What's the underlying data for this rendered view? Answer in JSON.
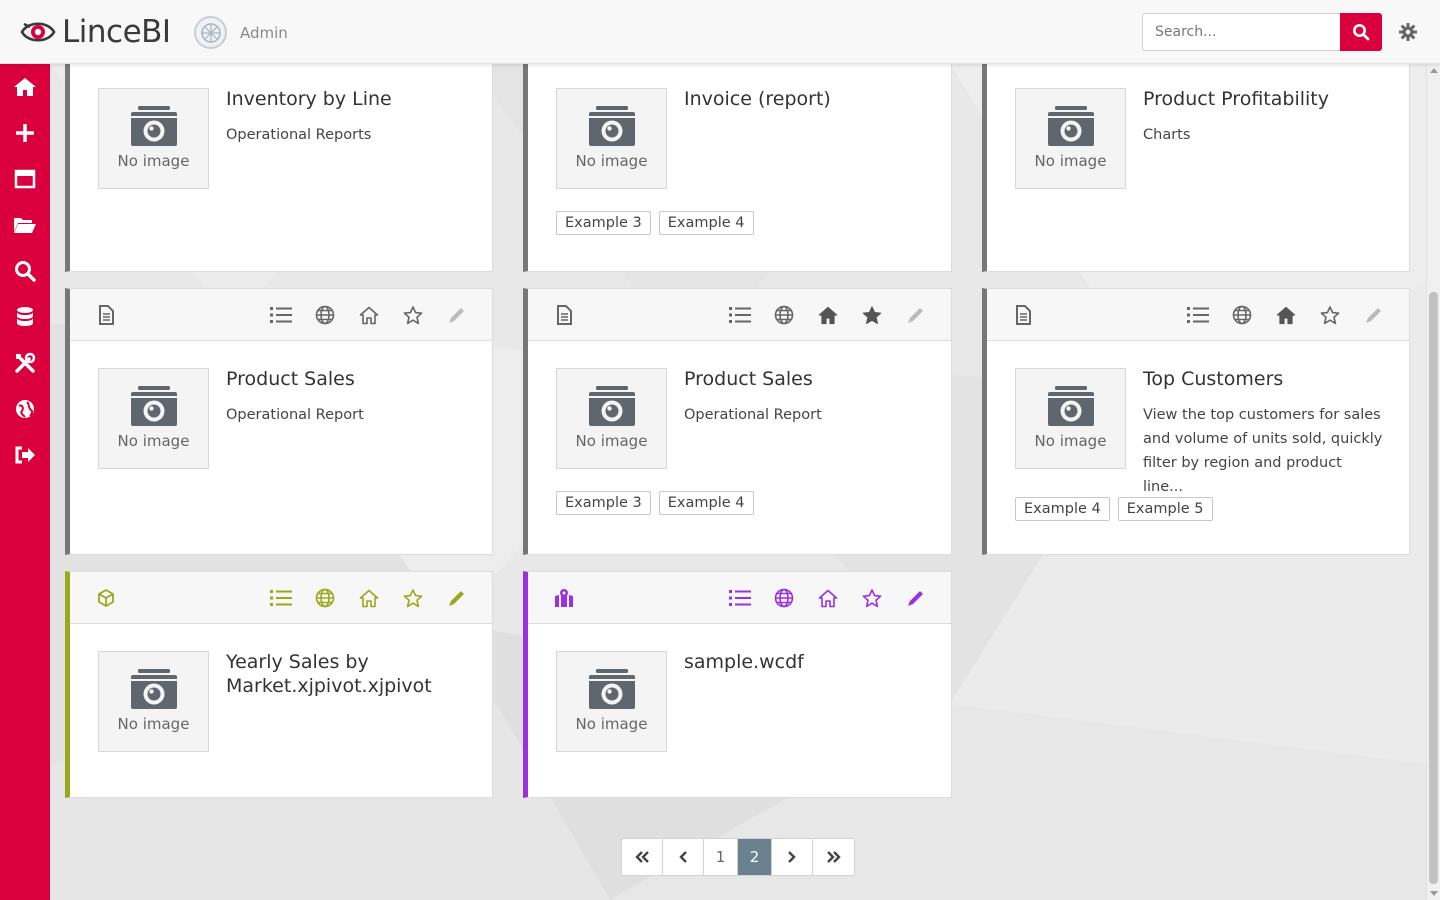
{
  "app": {
    "name": "LinceBI",
    "user": "Admin",
    "search_placeholder": "Search...",
    "brand_color": "#d9003d"
  },
  "sidebar": {
    "items": [
      {
        "icon": "home-icon"
      },
      {
        "icon": "plus-icon"
      },
      {
        "icon": "window-icon"
      },
      {
        "icon": "folder-open-icon"
      },
      {
        "icon": "search-icon"
      },
      {
        "icon": "database-icon"
      },
      {
        "icon": "tools-icon"
      },
      {
        "icon": "language-icon"
      },
      {
        "icon": "logout-icon"
      }
    ]
  },
  "cards": [
    {
      "title": "Inventory by Line",
      "desc": "Operational Reports",
      "no_image": "No image",
      "tags": [],
      "accent": "#777777"
    },
    {
      "title": "Invoice (report)",
      "desc": "",
      "no_image": "No image",
      "tags": [
        "Example 3",
        "Example 4"
      ],
      "accent": "#777777"
    },
    {
      "title": "Product Profitability",
      "desc": "Charts",
      "no_image": "No image",
      "tags": [],
      "accent": "#777777"
    },
    {
      "title": "Product Sales",
      "desc": "Operational Report",
      "no_image": "No image",
      "tags": [],
      "accent": "#777777",
      "home_filled": false,
      "star_filled": false
    },
    {
      "title": "Product Sales",
      "desc": "Operational Report",
      "no_image": "No image",
      "tags": [
        "Example 3",
        "Example 4"
      ],
      "accent": "#777777",
      "home_filled": true,
      "star_filled": true
    },
    {
      "title": "Top Customers",
      "desc": "View the top customers for sales and volume of units sold, quickly filter by region and product line...",
      "no_image": "No image",
      "tags": [
        "Example 4",
        "Example 5"
      ],
      "accent": "#777777",
      "home_filled": true,
      "star_filled": false
    },
    {
      "title": "Yearly Sales by Market.xjpivot.xjpivot",
      "desc": "",
      "no_image": "No image",
      "tags": [],
      "accent": "#9aa81a"
    },
    {
      "title": "sample.wcdf",
      "desc": "",
      "no_image": "No image",
      "tags": [],
      "accent": "#9b30e0"
    }
  ],
  "pagination": {
    "first": "«",
    "prev": "‹",
    "pages": [
      "1",
      "2"
    ],
    "current": "2",
    "next": "›",
    "last": "»"
  }
}
